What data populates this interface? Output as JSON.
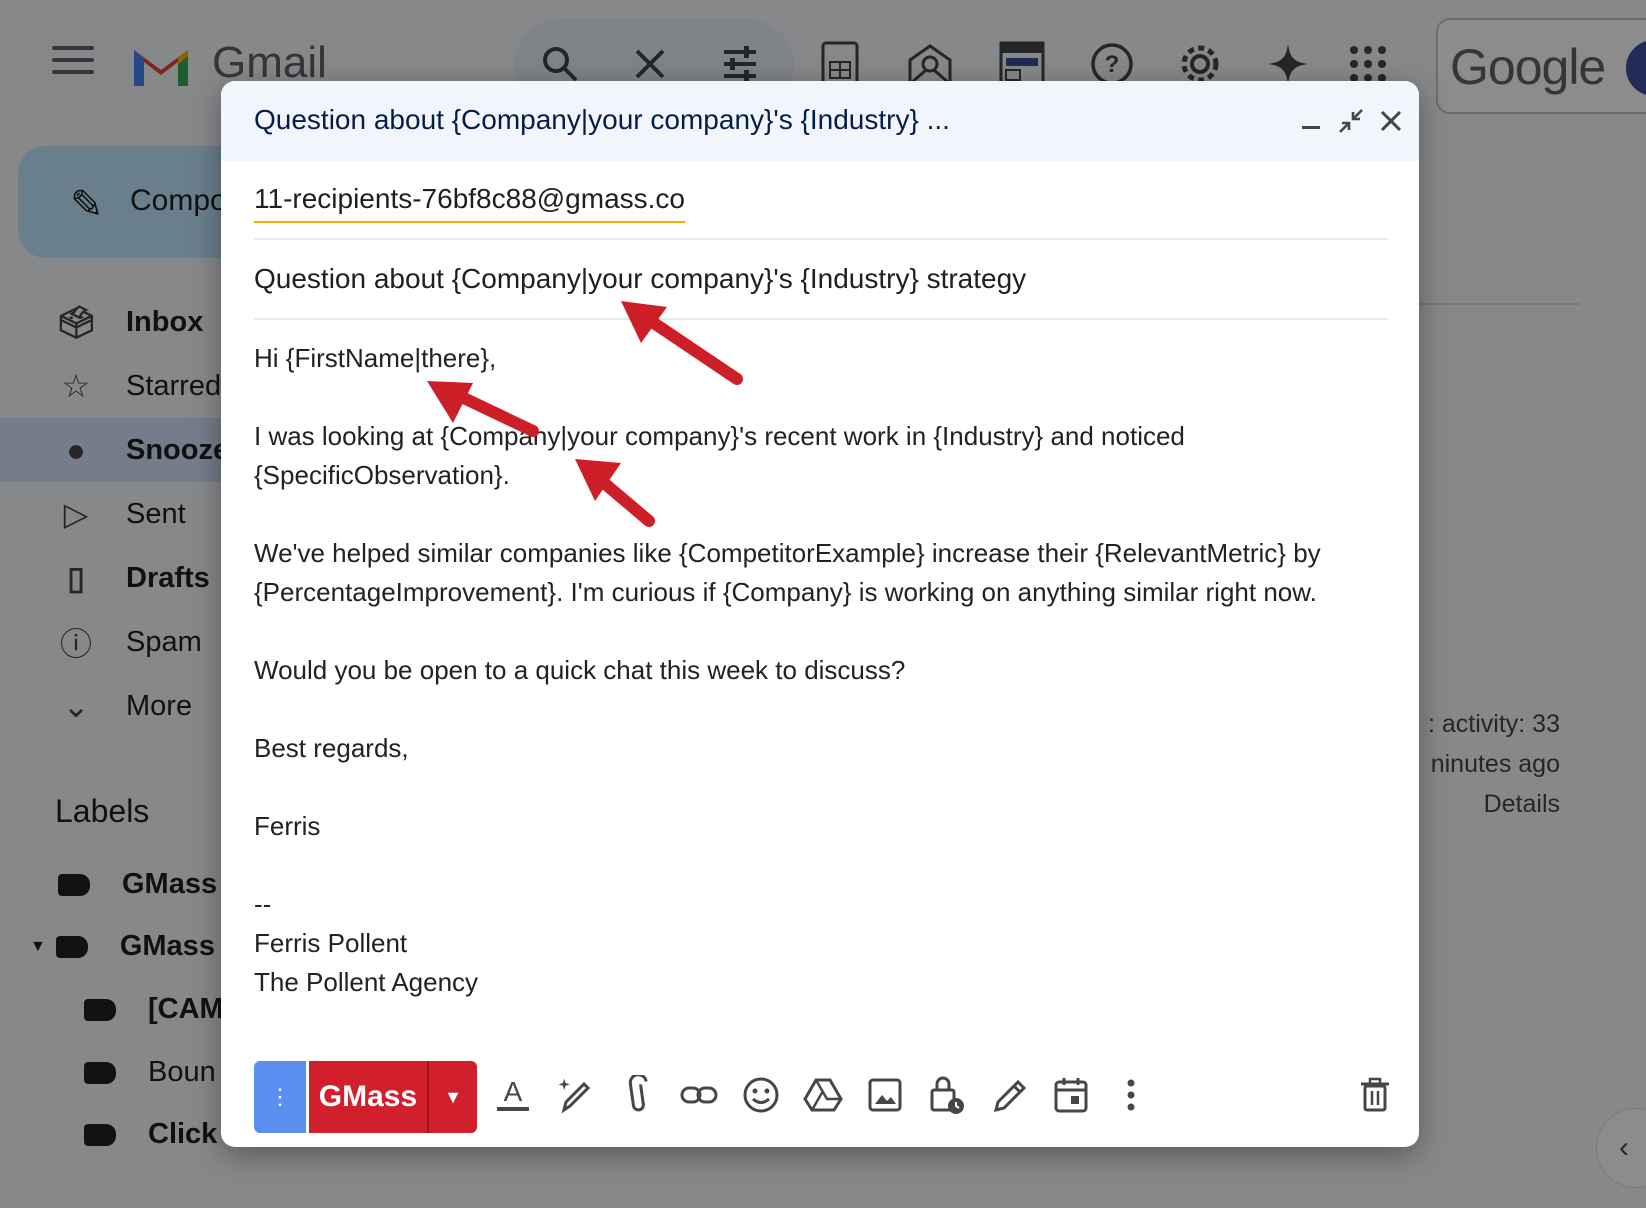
{
  "app": {
    "logo_text": "Gmail",
    "google_text": "Google"
  },
  "sidebar": {
    "compose_label": "Compo",
    "items": [
      {
        "label": "Inbox",
        "icon": "inbox-icon"
      },
      {
        "label": "Starred",
        "icon": "star-icon"
      },
      {
        "label": "Snooze",
        "icon": "clock-icon"
      },
      {
        "label": "Sent",
        "icon": "send-icon"
      },
      {
        "label": "Drafts",
        "icon": "draft-icon"
      },
      {
        "label": "Spam",
        "icon": "spam-icon"
      },
      {
        "label": "More",
        "icon": "chevron-down-icon"
      }
    ],
    "labels_title": "Labels",
    "labels": [
      "GMass",
      "GMass",
      "[CAM",
      "Boun",
      "Click"
    ]
  },
  "right_panel": {
    "activity": ": activity: 33",
    "minutes": "ninutes ago",
    "details": "Details"
  },
  "compose": {
    "title": "Question about {Company|your company}'s {Industry} ...",
    "to": "11-recipients-76bf8c88@gmass.co",
    "subject": "Question about {Company|your company}'s {Industry} strategy",
    "body": {
      "greeting": "Hi {FirstName|there},",
      "p1_line1": "I was looking at {Company|your company}'s recent work in {Industry} and noticed",
      "p1_line2": "{SpecificObservation}.",
      "p2_line1": "We've helped similar companies like {CompetitorExample} increase their {RelevantMetric} by",
      "p2_line2": "{PercentageImprovement}. I'm curious if {Company} is working on anything similar right now.",
      "p3": "Would you be open to a quick chat this week to discuss?",
      "closing": "Best regards,",
      "name": "Ferris",
      "sig_sep": "--",
      "sig_name": "Ferris Pollent",
      "sig_company": "The Pollent Agency"
    },
    "toolbar": {
      "gmass_label": "GMass"
    }
  },
  "colors": {
    "gmass_red": "#d11f2c",
    "blue_button": "#5a8ff0",
    "arrow_red": "#cc1f27",
    "header_bg": "#f2f6fc"
  }
}
